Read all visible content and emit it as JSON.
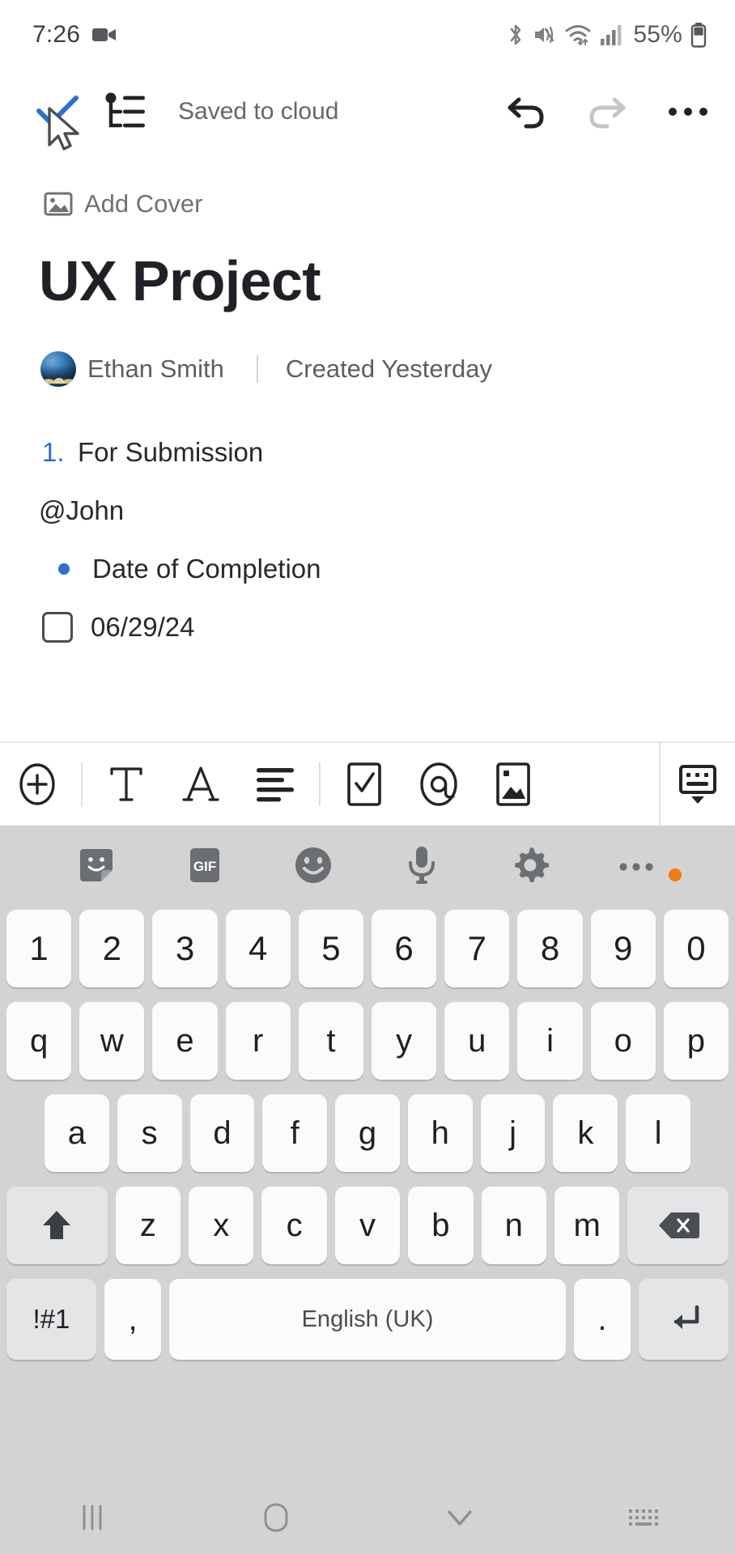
{
  "status_bar": {
    "time": "7:26",
    "battery_percent": "55%",
    "icons": [
      "video-recording-icon",
      "bluetooth-icon",
      "mute-vibrate-icon",
      "wifi-icon",
      "cellular-signal-icon",
      "battery-icon"
    ]
  },
  "app_bar": {
    "done_label": "done-check",
    "outline_label": "outline",
    "saved_status": "Saved to cloud",
    "undo_label": "undo",
    "redo_label": "redo",
    "more_label": "more options"
  },
  "document": {
    "add_cover_label": "Add Cover",
    "title": "UX Project",
    "author": "Ethan Smith",
    "created": "Created Yesterday",
    "blocks": [
      {
        "type": "ordered",
        "marker": "1.",
        "text": "For Submission"
      },
      {
        "type": "paragraph",
        "text": "@John"
      },
      {
        "type": "bullet",
        "text": "Date of Completion"
      },
      {
        "type": "checkbox",
        "checked": false,
        "text": "06/29/24"
      }
    ]
  },
  "format_toolbar": {
    "buttons": [
      {
        "name": "add-block-button",
        "icon": "plus-circle-icon"
      },
      {
        "name": "text-style-button",
        "icon": "text-T-icon"
      },
      {
        "name": "font-button",
        "icon": "font-A-icon"
      },
      {
        "name": "align-button",
        "icon": "align-left-icon"
      },
      {
        "name": "checklist-button",
        "icon": "checkbox-icon"
      },
      {
        "name": "mention-button",
        "icon": "at-mention-icon"
      },
      {
        "name": "image-button",
        "icon": "image-icon"
      },
      {
        "name": "hide-keyboard-button",
        "icon": "keyboard-down-icon"
      }
    ]
  },
  "keyboard": {
    "toolbar": [
      {
        "name": "sticker-button",
        "icon": "sticker-icon"
      },
      {
        "name": "gif-button",
        "icon": "gif-icon",
        "label": "GIF"
      },
      {
        "name": "emoji-button",
        "icon": "emoji-smiley-icon"
      },
      {
        "name": "voice-input-button",
        "icon": "microphone-icon"
      },
      {
        "name": "keyboard-settings-button",
        "icon": "gear-icon"
      },
      {
        "name": "keyboard-more-button",
        "icon": "more-dots-icon",
        "badge": true
      }
    ],
    "number_row": [
      "1",
      "2",
      "3",
      "4",
      "5",
      "6",
      "7",
      "8",
      "9",
      "0"
    ],
    "row_q": [
      "q",
      "w",
      "e",
      "r",
      "t",
      "y",
      "u",
      "i",
      "o",
      "p"
    ],
    "row_a": [
      "a",
      "s",
      "d",
      "f",
      "g",
      "h",
      "j",
      "k",
      "l"
    ],
    "row_z": [
      "z",
      "x",
      "c",
      "v",
      "b",
      "n",
      "m"
    ],
    "shift_key": "shift",
    "backspace_key": "backspace",
    "symbols_key": "!#1",
    "comma_key": ",",
    "space_key": "English (UK)",
    "period_key": ".",
    "enter_key": "enter"
  },
  "nav_bar": {
    "recents_label": "recents",
    "home_label": "home",
    "back_label": "hide-keyboard",
    "switch_keyboard_label": "switch-keyboard"
  },
  "colors": {
    "accent_blue": "#2f6fd0",
    "keyboard_bg": "#d3d3d3",
    "key_bg": "#fbfbfb",
    "badge_orange": "#f07a16"
  }
}
